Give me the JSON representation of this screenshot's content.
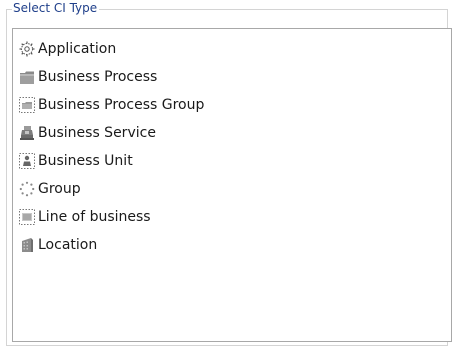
{
  "panel": {
    "legend": "Select CI Type"
  },
  "ci_types": [
    {
      "label": "Application",
      "icon": "gear-dotted-icon"
    },
    {
      "label": "Business Process",
      "icon": "folder-icon"
    },
    {
      "label": "Business Process Group",
      "icon": "folder-group-icon"
    },
    {
      "label": "Business Service",
      "icon": "service-icon"
    },
    {
      "label": "Business Unit",
      "icon": "business-unit-icon"
    },
    {
      "label": "Group",
      "icon": "group-icon"
    },
    {
      "label": "Line of business",
      "icon": "line-of-business-icon"
    },
    {
      "label": "Location",
      "icon": "building-icon"
    }
  ]
}
